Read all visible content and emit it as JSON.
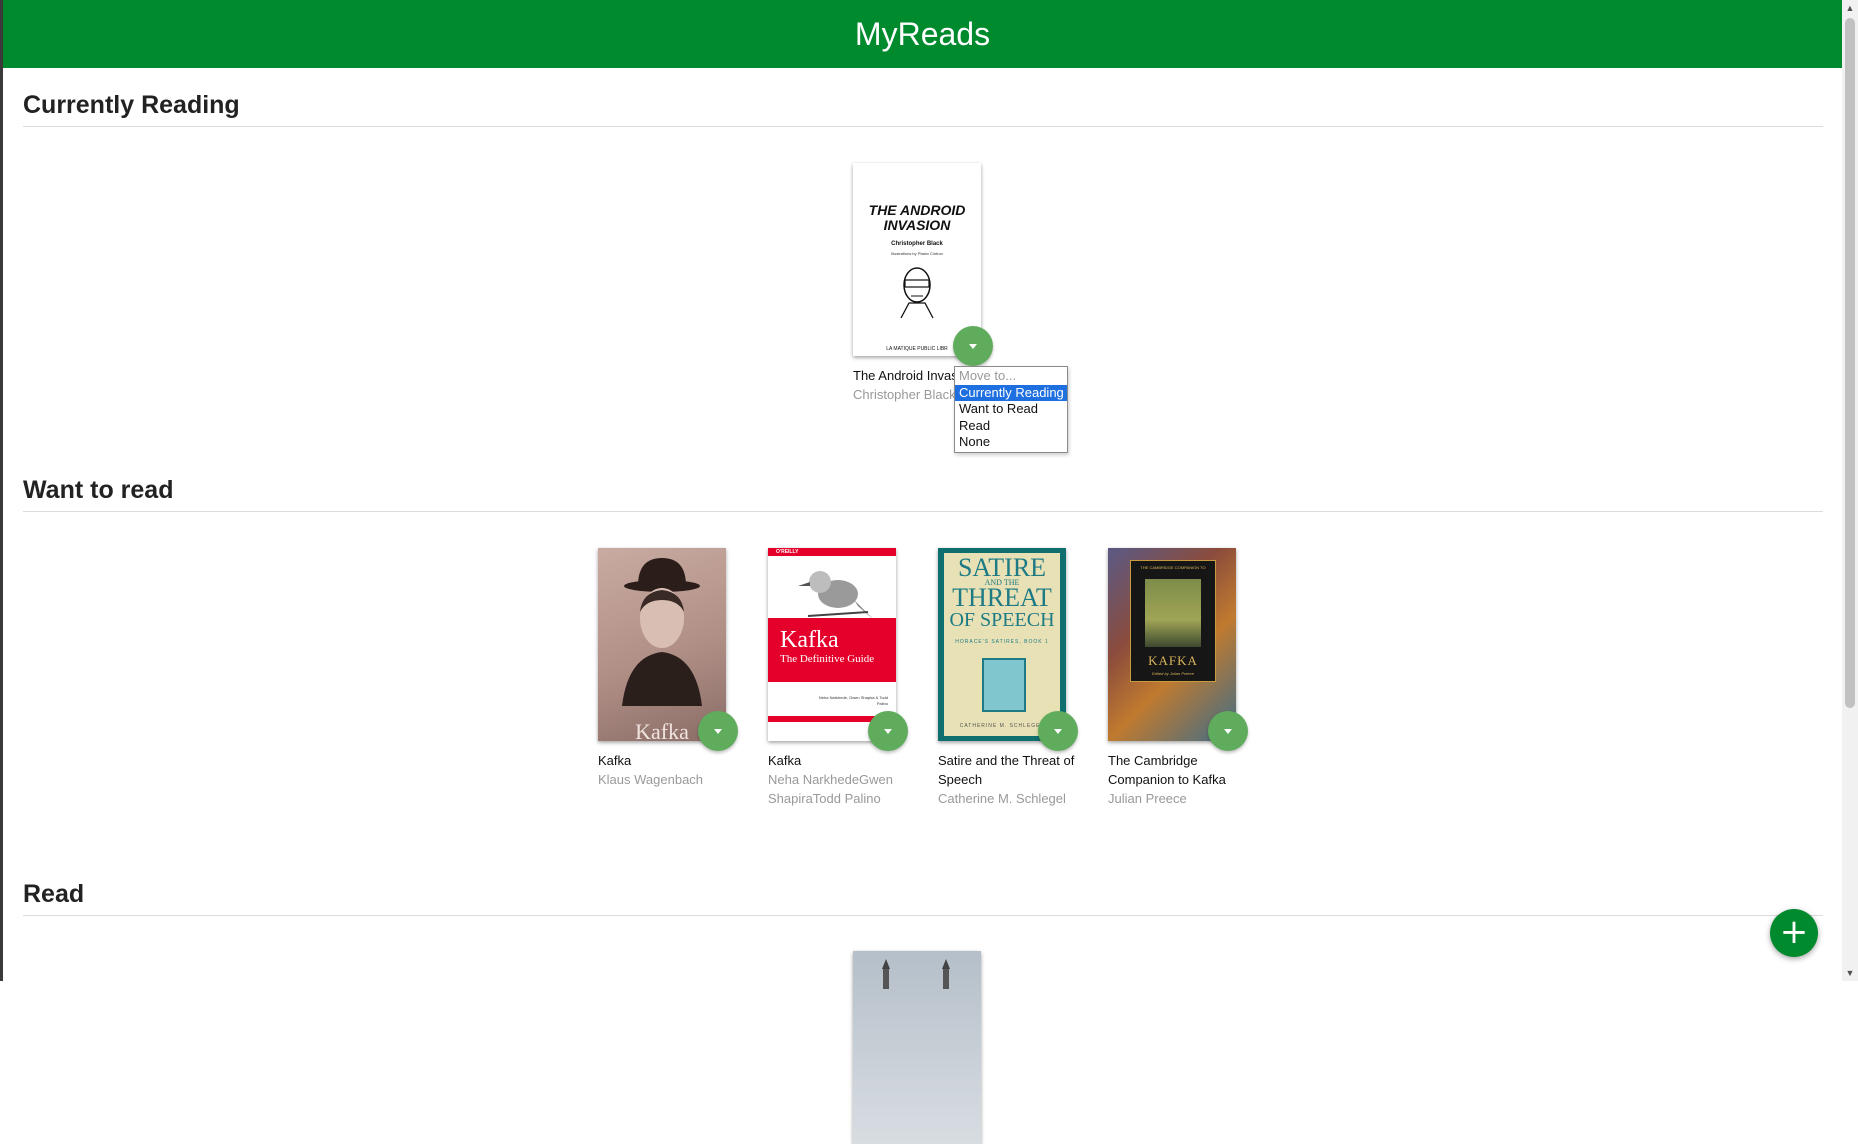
{
  "app": {
    "title": "MyReads"
  },
  "shelves": [
    {
      "title": "Currently Reading",
      "books": [
        {
          "title": "The Android Invas",
          "authors": "Christopher Black",
          "cover_text": {
            "title": "THE ANDROID INVASION",
            "author": "Christopher Black",
            "illustrator": "Illustrations by Plasto Cintron",
            "footer": "LA MATIQUE PUBLIC LIBR"
          }
        }
      ]
    },
    {
      "title": "Want to read",
      "books": [
        {
          "title": "Kafka",
          "authors": "Klaus Wagenbach",
          "cover_text": {
            "word": "Kafka"
          }
        },
        {
          "title": "Kafka",
          "authors": "Neha NarkhedeGwen ShapiraTodd Palino",
          "cover_text": {
            "publisher": "O'REILLY",
            "title": "Kafka",
            "subtitle": "The Definitive Guide",
            "authors": "Neha Narkhede, Gwen Shapira & Todd Palino"
          }
        },
        {
          "title": "Satire and the Threat of Speech",
          "authors": "Catherine M. Schlegel",
          "cover_text": {
            "line1": "SATIRE",
            "line2": "AND THE",
            "line3": "THREAT",
            "line4": "OF SPEECH",
            "sub": "HORACE'S SATIRES, BOOK 1",
            "author": "CATHERINE M. SCHLEGEL"
          }
        },
        {
          "title": "The Cambridge Companion to Kafka",
          "authors": "Julian Preece",
          "cover_text": {
            "top": "THE CAMBRIDGE COMPANION TO",
            "title": "KAFKA",
            "editor": "Edited by Julian Preece"
          }
        }
      ]
    },
    {
      "title": "Read",
      "books": []
    }
  ],
  "shelf_menu": {
    "options": [
      "Move to...",
      "Currently Reading",
      "Want to Read",
      "Read",
      "None"
    ],
    "selected": "Currently Reading",
    "disabled": "Move to..."
  },
  "add_button": {
    "label": "+"
  },
  "colors": {
    "header": "#008a2e",
    "changer": "#60ac5d",
    "menu_highlight": "#1e6fe0"
  }
}
